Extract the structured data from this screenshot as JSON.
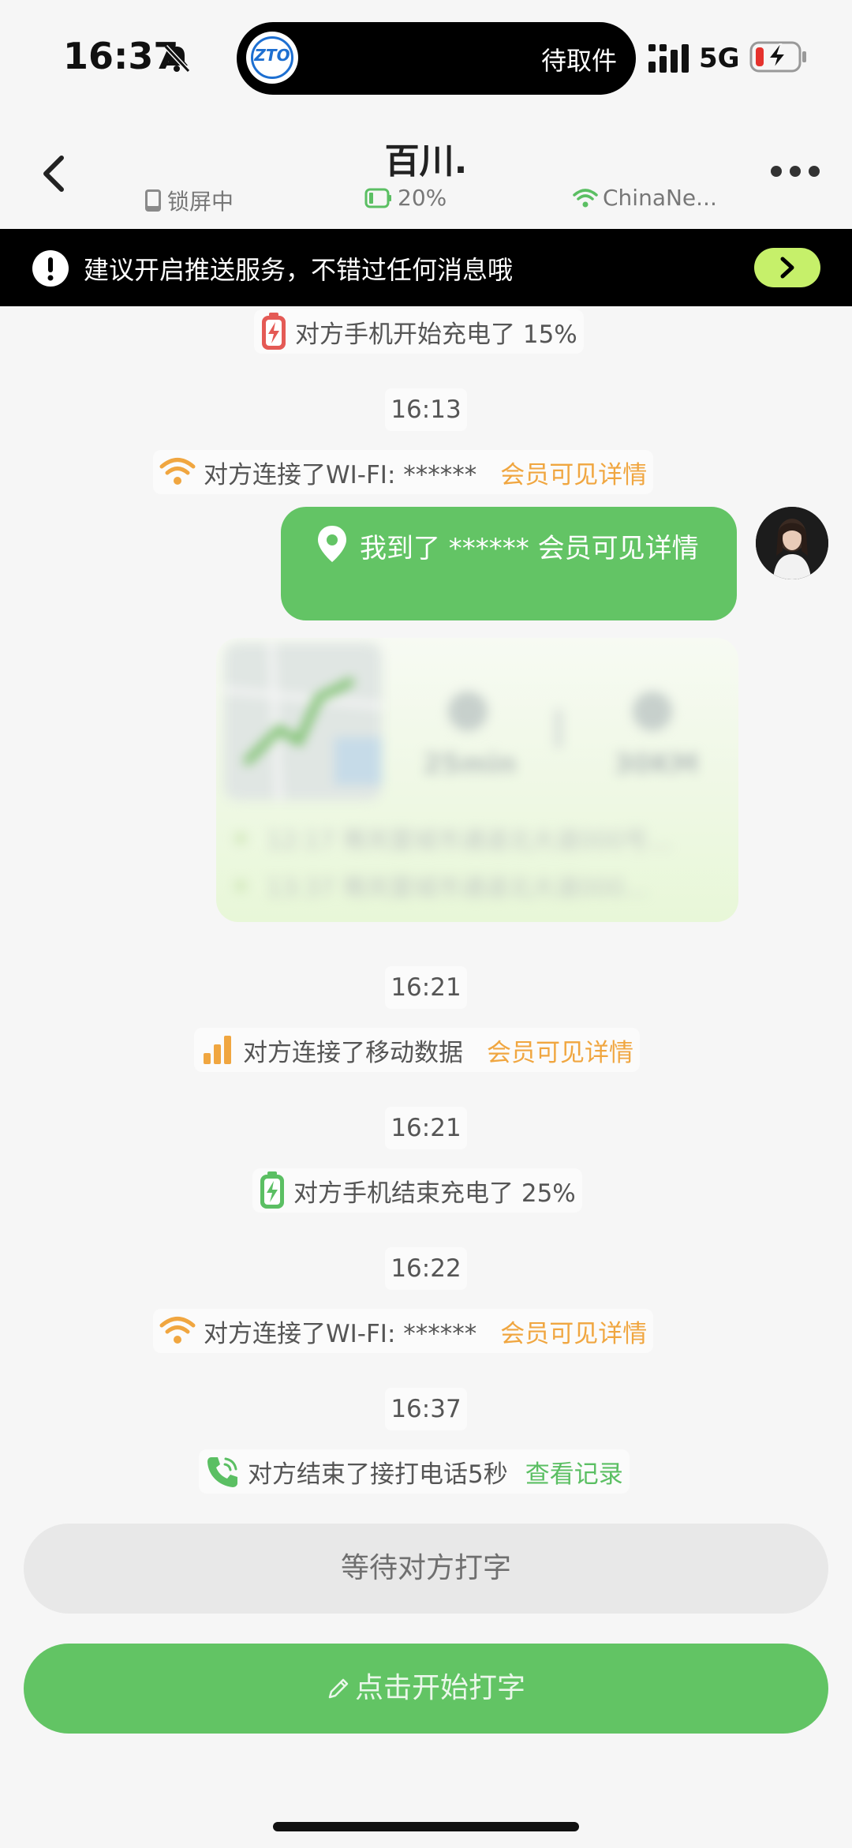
{
  "status_bar": {
    "time": "16:37",
    "island_text": "待取件",
    "island_logo": "ZTO",
    "network": "5G"
  },
  "header": {
    "title": "百川.",
    "lock_status": "锁屏中",
    "battery": "20%",
    "wifi": "ChinaNe..."
  },
  "banner": {
    "text": "建议开启推送服务，不错过任何消息哦"
  },
  "messages": {
    "charge_start": "对方手机开始充电了 15%",
    "time1": "16:13",
    "wifi1": "对方连接了WI-FI:   ******",
    "member1": "会员可见详情",
    "bubble": "我到了 ****** 会员可见详情",
    "time2": "16:21",
    "mobile": "对方连接了移动数据",
    "member2": "会员可见详情",
    "time3": "16:21",
    "charge_end": "对方手机结束充电了 25%",
    "time4": "16:22",
    "wifi2": "对方连接了WI-FI:   ******",
    "member3": "会员可见详情",
    "time5": "16:37",
    "call": "对方结束了接打电话5秒",
    "record": "查看记录"
  },
  "route_card": {
    "duration": "25min",
    "distance": "30KM",
    "row1": "12:17  骞岚雷城市通道北大道000号…",
    "row2": "13:37  骞岚雷城市通道北大道000…"
  },
  "buttons": {
    "wait": "等待对方打字",
    "type": "点击开始打字"
  },
  "colors": {
    "accent_green": "#63c465",
    "member_orange": "#f0a640",
    "banner_button": "#c6f06a"
  },
  "icons": [
    "bell-slash-icon",
    "signal-icon",
    "battery-charging-icon",
    "back-icon",
    "phone-icon",
    "battery-icon",
    "wifi-icon",
    "more-icon",
    "alert-icon",
    "chevron-right-icon",
    "charging-icon",
    "location-pin-icon",
    "bar-chart-icon",
    "phone-call-icon",
    "pencil-icon"
  ]
}
